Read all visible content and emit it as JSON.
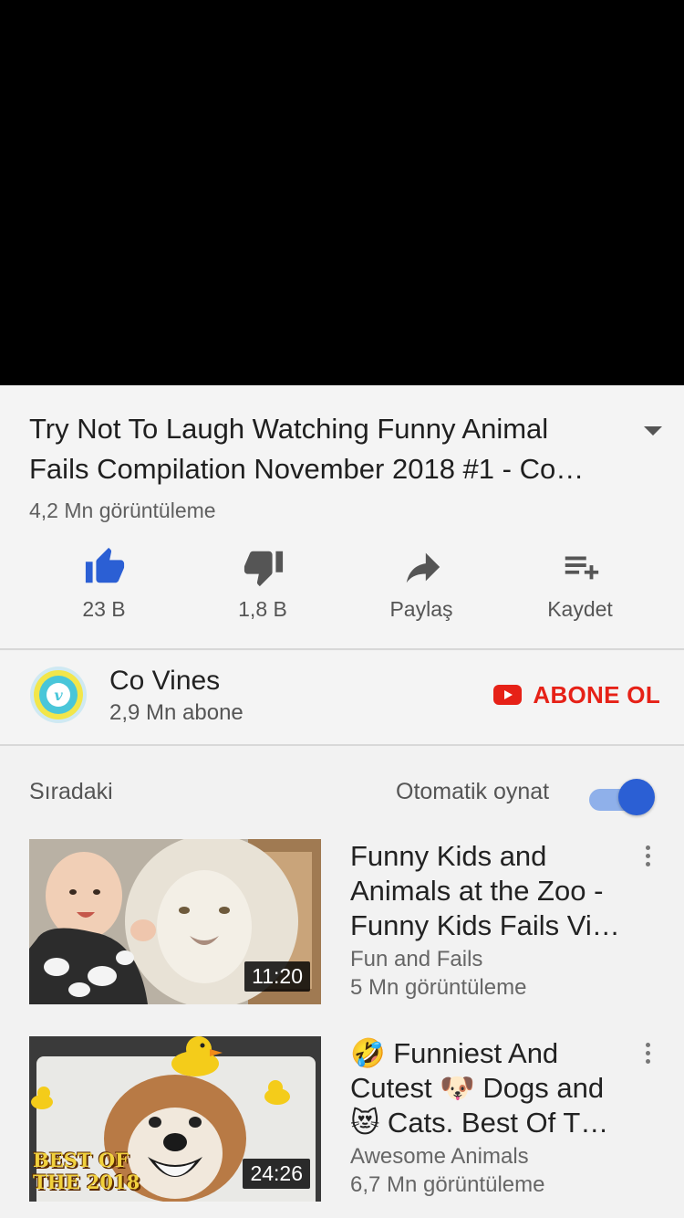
{
  "video": {
    "title": "Try Not To Laugh Watching Funny Animal Fails Compilation November 2018 #1 - Co…",
    "views": "4,2 Mn görüntüleme"
  },
  "actions": {
    "like": "23 B",
    "dislike": "1,8 B",
    "share": "Paylaş",
    "save": "Kaydet"
  },
  "channel": {
    "name": "Co Vines",
    "subscribers": "2,9 Mn abone",
    "subscribe_label": "ABONE OL"
  },
  "up_next": {
    "label": "Sıradaki",
    "autoplay_label": "Otomatik oynat",
    "autoplay_on": true
  },
  "videos": [
    {
      "title": "Funny Kids and Animals at the Zoo - Funny Kids Fails Vi…",
      "channel": "Fun and Fails",
      "views": "5 Mn görüntüleme",
      "duration": "11:20"
    },
    {
      "title": "🤣 Funniest And Cutest 🐶 Dogs and 😻 Cats. Best Of T…",
      "channel": "Awesome Animals",
      "views": "6,7 Mn görüntüleme",
      "duration": "24:26",
      "thumb_text_1": "BEST OF",
      "thumb_text_2": "THE 2018"
    }
  ],
  "colors": {
    "like_active": "#2b5fd4",
    "subscribe_red": "#e62117",
    "toggle_track": "#8fb0ea",
    "toggle_knob": "#2b5fd4"
  },
  "icons": [
    "expand-icon",
    "like-icon",
    "dislike-icon",
    "share-icon",
    "save-to-playlist-icon",
    "youtube-icon",
    "more-options-icon"
  ]
}
